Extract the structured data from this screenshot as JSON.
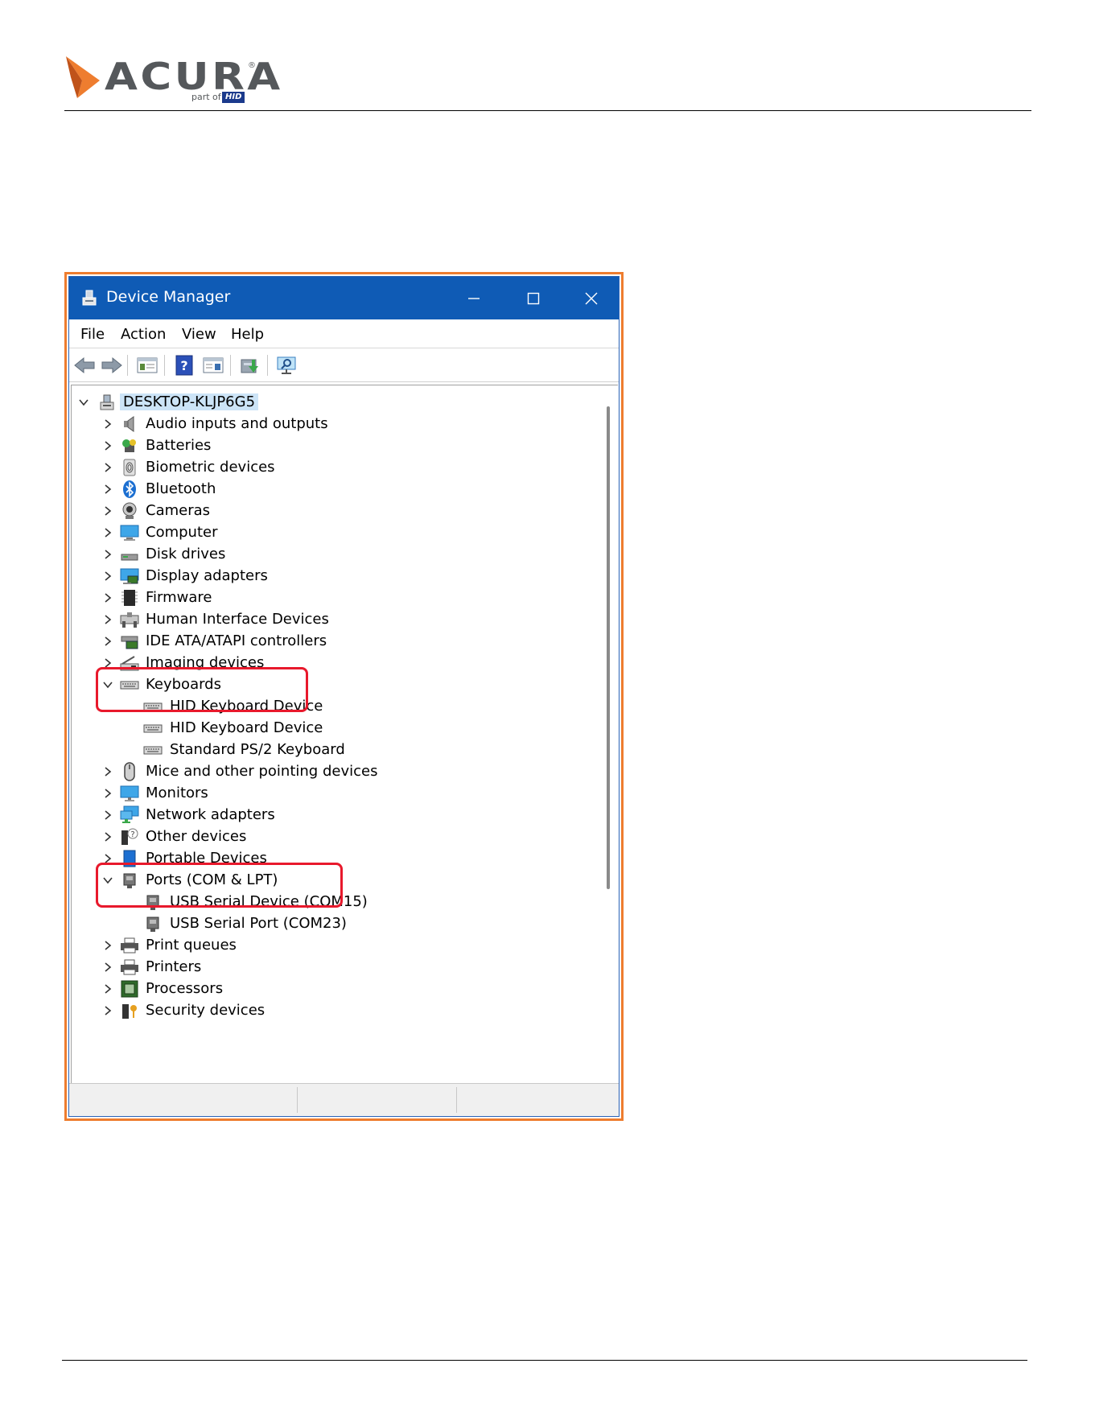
{
  "brand": {
    "name": "ACURA",
    "registered": "®",
    "part_of": "part of",
    "parent": "HID",
    "colors": {
      "mark_orange": "#ee7d2f",
      "word_gray": "#55585b",
      "hid_blue": "#1b3a8c"
    }
  },
  "window": {
    "title": "Device Manager",
    "app_icon": "device-manager-icon",
    "controls": [
      "minimize-icon",
      "maximize-icon",
      "close-icon"
    ]
  },
  "menu": [
    "File",
    "Action",
    "View",
    "Help"
  ],
  "toolbar": [
    "back-arrow-icon",
    "forward-arrow-icon",
    "properties-icon",
    "help-icon",
    "details-view-icon",
    "update-driver-icon",
    "scan-hardware-icon"
  ],
  "tree": {
    "root": "DESKTOP-KLJP6G5",
    "items": [
      {
        "label": "Audio inputs and outputs",
        "icon": "speaker-icon"
      },
      {
        "label": "Batteries",
        "icon": "battery-icon"
      },
      {
        "label": "Biometric devices",
        "icon": "fingerprint-icon"
      },
      {
        "label": "Bluetooth",
        "icon": "bluetooth-icon"
      },
      {
        "label": "Cameras",
        "icon": "camera-icon"
      },
      {
        "label": "Computer",
        "icon": "computer-icon"
      },
      {
        "label": "Disk drives",
        "icon": "disk-drive-icon"
      },
      {
        "label": "Display adapters",
        "icon": "display-adapter-icon"
      },
      {
        "label": "Firmware",
        "icon": "firmware-icon"
      },
      {
        "label": "Human Interface Devices",
        "icon": "hid-icon"
      },
      {
        "label": "IDE ATA/ATAPI controllers",
        "icon": "ide-controller-icon"
      },
      {
        "label": "Imaging devices",
        "icon": "scanner-icon"
      },
      {
        "label": "Keyboards",
        "icon": "keyboard-icon",
        "expanded": true,
        "children": [
          "HID Keyboard Device",
          "HID Keyboard Device",
          "Standard PS/2 Keyboard"
        ]
      },
      {
        "label": "Mice and other pointing devices",
        "icon": "mouse-icon"
      },
      {
        "label": "Monitors",
        "icon": "monitor-icon"
      },
      {
        "label": "Network adapters",
        "icon": "network-adapter-icon"
      },
      {
        "label": "Other devices",
        "icon": "unknown-device-icon"
      },
      {
        "label": "Portable Devices",
        "icon": "portable-device-icon"
      },
      {
        "label": "Ports (COM & LPT)",
        "icon": "port-icon",
        "expanded": true,
        "children": [
          "USB Serial Device (COM15)",
          "USB Serial Port (COM23)"
        ]
      },
      {
        "label": "Print queues",
        "icon": "printer-icon"
      },
      {
        "label": "Printers",
        "icon": "printer-icon"
      },
      {
        "label": "Processors",
        "icon": "processor-icon"
      },
      {
        "label": "Security devices",
        "icon": "security-device-icon"
      }
    ]
  },
  "highlight_color": "#e8192c"
}
